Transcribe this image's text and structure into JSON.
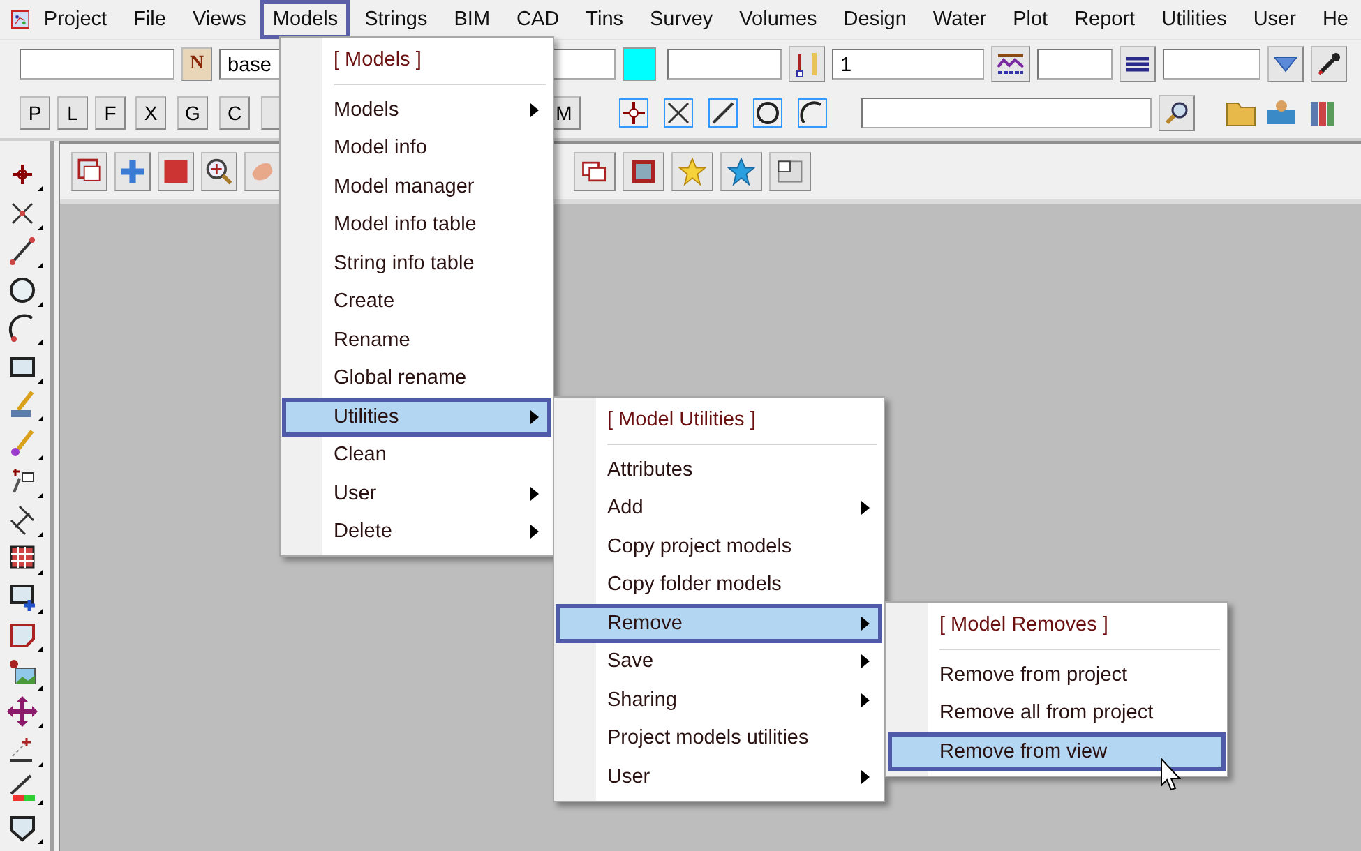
{
  "menubar": [
    {
      "label": "Project",
      "selected": false
    },
    {
      "label": "File",
      "selected": false
    },
    {
      "label": "Views",
      "selected": false
    },
    {
      "label": "Models",
      "selected": true
    },
    {
      "label": "Strings",
      "selected": false
    },
    {
      "label": "BIM",
      "selected": false
    },
    {
      "label": "CAD",
      "selected": false
    },
    {
      "label": "Tins",
      "selected": false
    },
    {
      "label": "Survey",
      "selected": false
    },
    {
      "label": "Volumes",
      "selected": false
    },
    {
      "label": "Design",
      "selected": false
    },
    {
      "label": "Water",
      "selected": false
    },
    {
      "label": "Plot",
      "selected": false
    },
    {
      "label": "Report",
      "selected": false
    },
    {
      "label": "Utilities",
      "selected": false
    },
    {
      "label": "User",
      "selected": false
    },
    {
      "label": "He",
      "selected": false
    }
  ],
  "toolbar_1": {
    "name_button": "N",
    "model_field": "base",
    "value_field": "1"
  },
  "toolbar_2": {
    "letter_buttons": [
      "P",
      "L",
      "F",
      "X",
      "G",
      "C"
    ],
    "mode_button": "M"
  },
  "menus": [
    {
      "header": "[ Models ]",
      "items": [
        {
          "label": "Models",
          "submenu": true,
          "selected": false
        },
        {
          "label": "Model info",
          "submenu": false,
          "selected": false
        },
        {
          "label": "Model manager",
          "submenu": false,
          "selected": false
        },
        {
          "label": "Model info table",
          "submenu": false,
          "selected": false
        },
        {
          "label": "String info table",
          "submenu": false,
          "selected": false
        },
        {
          "label": "Create",
          "submenu": false,
          "selected": false
        },
        {
          "label": "Rename",
          "submenu": false,
          "selected": false
        },
        {
          "label": "Global rename",
          "submenu": false,
          "selected": false
        },
        {
          "label": "Utilities",
          "submenu": true,
          "selected": true
        },
        {
          "label": "Clean",
          "submenu": false,
          "selected": false
        },
        {
          "label": "User",
          "submenu": true,
          "selected": false
        },
        {
          "label": "Delete",
          "submenu": true,
          "selected": false
        }
      ]
    },
    {
      "header": "[ Model Utilities ]",
      "items": [
        {
          "label": "Attributes",
          "submenu": false,
          "selected": false
        },
        {
          "label": "Add",
          "submenu": true,
          "selected": false
        },
        {
          "label": "Copy project models",
          "submenu": false,
          "selected": false
        },
        {
          "label": "Copy folder models",
          "submenu": false,
          "selected": false
        },
        {
          "label": "Remove",
          "submenu": true,
          "selected": true
        },
        {
          "label": "Save",
          "submenu": true,
          "selected": false
        },
        {
          "label": "Sharing",
          "submenu": true,
          "selected": false
        },
        {
          "label": "Project models utilities",
          "submenu": false,
          "selected": false
        },
        {
          "label": "User",
          "submenu": true,
          "selected": false
        }
      ]
    },
    {
      "header": "[ Model Removes ]",
      "items": [
        {
          "label": "Remove from project",
          "submenu": false,
          "selected": false
        },
        {
          "label": "Remove all from project",
          "submenu": false,
          "selected": false
        },
        {
          "label": "Remove from view",
          "submenu": false,
          "selected": true
        }
      ]
    }
  ]
}
